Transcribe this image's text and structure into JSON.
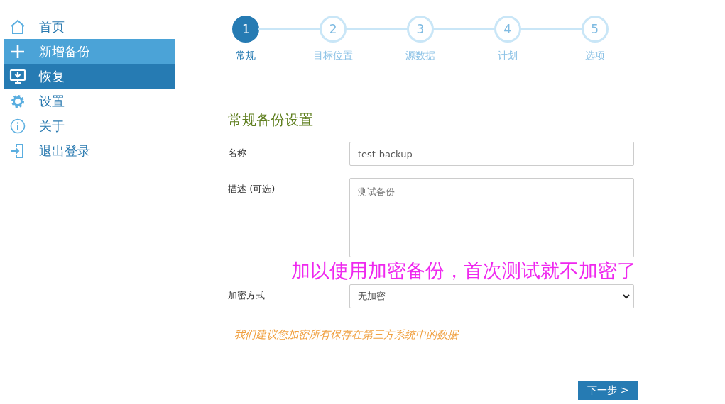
{
  "sidebar": {
    "items": [
      {
        "label": "首页",
        "selected": false,
        "hovered": false
      },
      {
        "label": "新增备份",
        "selected": false,
        "hovered": true
      },
      {
        "label": "恢复",
        "selected": true,
        "hovered": false
      },
      {
        "label": "设置",
        "selected": false,
        "hovered": false
      },
      {
        "label": "关于",
        "selected": false,
        "hovered": false
      },
      {
        "label": "退出登录",
        "selected": false,
        "hovered": false
      }
    ]
  },
  "steps": [
    {
      "number": "1",
      "label": "常规",
      "selected": true
    },
    {
      "number": "2",
      "label": "目标位置",
      "selected": false
    },
    {
      "number": "3",
      "label": "源数据",
      "selected": false
    },
    {
      "number": "4",
      "label": "计划",
      "selected": false
    },
    {
      "number": "5",
      "label": "选项",
      "selected": false
    }
  ],
  "form": {
    "title": "常规备份设置",
    "name": {
      "label": "名称",
      "value": "test-backup"
    },
    "description": {
      "label": "描述 (可选)",
      "placeholder": "测试备份"
    },
    "encryption": {
      "label": "加密方式",
      "value": "无加密"
    },
    "hint": "我们建议您加密所有保存在第三方系统中的数据",
    "next_button": "下一步 >"
  },
  "annotation": "加以使用加密备份，首次测试就不加密了"
}
